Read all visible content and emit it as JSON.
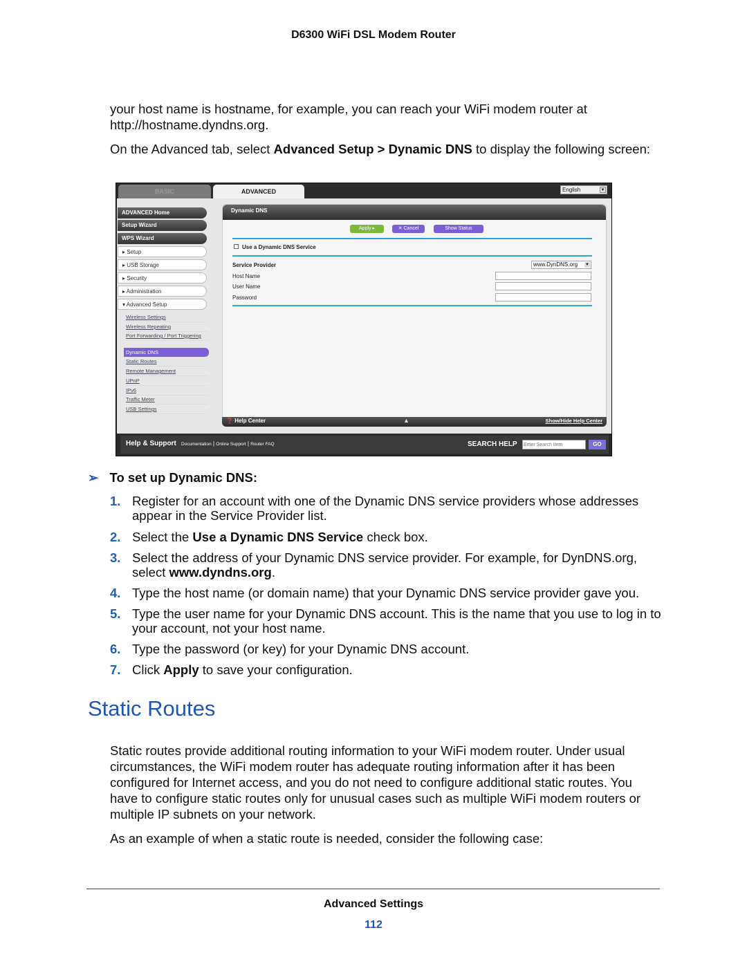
{
  "header": {
    "title": "D6300 WiFi DSL Modem Router"
  },
  "intro": {
    "p1": "your host name is hostname, for example, you can reach your WiFi modem router at http://hostname.dyndns.org.",
    "p2_a": "On the Advanced tab, select ",
    "p2_b": "Advanced Setup > Dynamic DNS",
    "p2_c": " to display the following screen:"
  },
  "screenshot": {
    "tabs": [
      "BASIC",
      "ADVANCED"
    ],
    "language": "English",
    "nav_dark": [
      "ADVANCED Home",
      "Setup Wizard",
      "WPS Wizard"
    ],
    "nav_light": [
      "▸ Setup",
      "▸ USB Storage",
      "▸ Security",
      "▸ Administration",
      "▾ Advanced Setup"
    ],
    "submenu": [
      "Wireless Settings",
      "Wireless Repeating",
      "Port Forwarding / Port Triggering",
      "Dynamic DNS",
      "Static Routes",
      "Remote Management",
      "UPnP",
      "IPv6",
      "Traffic Meter",
      "USB Settings"
    ],
    "selected_submenu": "Dynamic DNS",
    "panel_title": "Dynamic DNS",
    "buttons": {
      "apply": "Apply ▸",
      "cancel": "✕ Cancel",
      "status": "Show Status"
    },
    "checkbox_label": "Use a Dynamic DNS Service",
    "checkbox_checked": false,
    "fields": {
      "service_provider": "Service Provider",
      "host_name": "Host Name",
      "user_name": "User Name",
      "password": "Password"
    },
    "service_provider_value": "www.DynDNS.org",
    "help_center": "Help Center",
    "show_hide": "Show/Hide Help Center",
    "footer": {
      "title": "Help & Support",
      "links": [
        "Documentation",
        "Online Support",
        "Router FAQ"
      ],
      "search_label": "SEARCH HELP",
      "search_placeholder": "Enter Search Item",
      "go": "GO"
    }
  },
  "procedure": {
    "title": "To set up Dynamic DNS:",
    "steps": [
      {
        "n": "1.",
        "a": "Register for an account with one of the Dynamic DNS service providers whose addresses appear in the Service Provider list.",
        "b": "",
        "c": ""
      },
      {
        "n": "2.",
        "a": "Select the ",
        "b": "Use a Dynamic DNS Service",
        "c": " check box."
      },
      {
        "n": "3.",
        "a": "Select the address of your Dynamic DNS service provider. For example, for DynDNS.org, select ",
        "b": "www.dyndns.org",
        "c": "."
      },
      {
        "n": "4.",
        "a": "Type the host name (or domain name) that your Dynamic DNS service provider gave you.",
        "b": "",
        "c": ""
      },
      {
        "n": "5.",
        "a": "Type the user name for your Dynamic DNS account. This is the name that you use to log in to your account, not your host name.",
        "b": "",
        "c": ""
      },
      {
        "n": "6.",
        "a": "Type the password (or key) for your Dynamic DNS account.",
        "b": "",
        "c": ""
      },
      {
        "n": "7.",
        "a": "Click ",
        "b": "Apply",
        "c": " to save your configuration."
      }
    ]
  },
  "static_routes": {
    "heading": "Static Routes",
    "p1": "Static routes provide additional routing information to your WiFi modem router. Under usual circumstances, the WiFi modem router has adequate routing information after it has been configured for Internet access, and you do not need to configure additional static routes. You have to configure static routes only for unusual cases such as multiple WiFi modem routers or multiple IP subnets on your network.",
    "p2": "As an example of when a static route is needed, consider the following case:"
  },
  "footer": {
    "section": "Advanced Settings",
    "page": "112"
  },
  "colors": {
    "accent": "#1e56b8",
    "step_number": "#1e5fb3",
    "apply_green": "#7cb83a",
    "purple": "#7a5fd6",
    "rule_blue": "#2aa4dc"
  }
}
